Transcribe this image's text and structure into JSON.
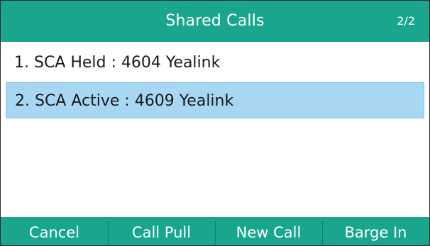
{
  "header": {
    "title": "Shared Calls",
    "page_indicator": "2/2"
  },
  "list": {
    "items": [
      {
        "label": "1. SCA Held : 4604 Yealink",
        "selected": false
      },
      {
        "label": "2. SCA Active : 4609 Yealink",
        "selected": true
      }
    ]
  },
  "softkeys": [
    {
      "label": "Cancel"
    },
    {
      "label": "Call Pull"
    },
    {
      "label": "New Call"
    },
    {
      "label": "Barge In"
    }
  ],
  "colors": {
    "accent": "#1aa68e",
    "selection": "#a8d7f3"
  }
}
